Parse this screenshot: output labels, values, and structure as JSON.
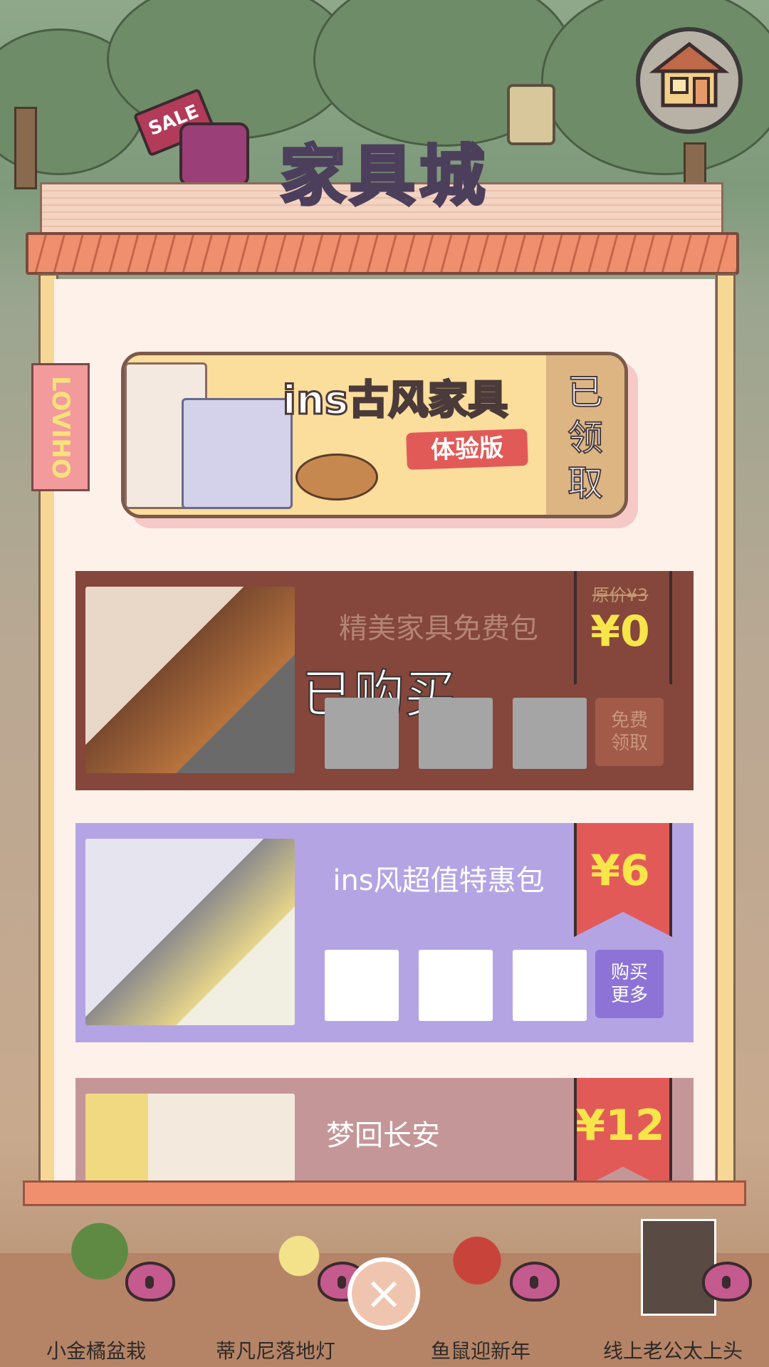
{
  "shop": {
    "title": "家具城",
    "tag": "LOVIHO"
  },
  "header": {
    "sale_sign": "SALE"
  },
  "featured": {
    "title": "ins古风家具",
    "badge": "体验版",
    "status": "已领取"
  },
  "packs": [
    {
      "name": "精美家具免费包",
      "original_price": "原价¥3",
      "price": "¥0",
      "overlay": "已购买",
      "action": "免费领取",
      "color": "#85463b",
      "flag_color": "#85463b",
      "button_color": "#a25b48"
    },
    {
      "name": "ins风超值特惠包",
      "price": "¥6",
      "action": "购买更多",
      "color": "#b4a4e4",
      "flag_color": "#e25a58",
      "button_color": "#8d73d6"
    },
    {
      "name": "梦回长安",
      "price": "¥12",
      "color": "#c59698",
      "flag_color": "#e25a58"
    }
  ],
  "bottom": {
    "items": [
      {
        "label": "小金橘盆栽"
      },
      {
        "label": "蒂凡尼落地灯"
      },
      {
        "label": "鱼鼠迎新年"
      },
      {
        "label": "线上老公太上头"
      }
    ],
    "close": "×"
  }
}
